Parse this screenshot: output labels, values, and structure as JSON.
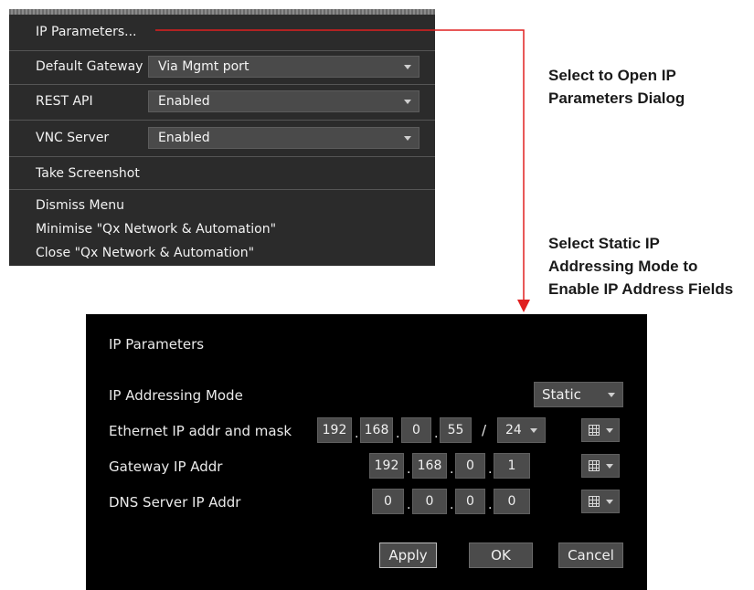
{
  "menu": {
    "ip_parameters": "IP Parameters...",
    "default_gateway": {
      "label": "Default Gateway",
      "value": "Via Mgmt port"
    },
    "rest_api": {
      "label": "REST API",
      "value": "Enabled"
    },
    "vnc_server": {
      "label": "VNC Server",
      "value": "Enabled"
    },
    "take_screenshot": "Take Screenshot",
    "dismiss_menu": "Dismiss Menu",
    "minimise": "Minimise \"Qx Network & Automation\"",
    "close": "Close \"Qx Network & Automation\""
  },
  "callouts": {
    "first": [
      "Select to Open IP",
      "Parameters Dialog"
    ],
    "second": [
      "Select Static IP",
      "Addressing Mode to",
      "Enable IP Address Fields"
    ]
  },
  "dialog": {
    "title": "IP Parameters",
    "addressing_mode": {
      "label": "IP Addressing Mode",
      "value": "Static"
    },
    "ethernet": {
      "label": "Ethernet IP addr and mask",
      "octets": [
        "192",
        "168",
        "0",
        "55"
      ],
      "mask": "24"
    },
    "gateway": {
      "label": "Gateway IP Addr",
      "octets": [
        "192",
        "168",
        "0",
        "1"
      ]
    },
    "dns": {
      "label": "DNS Server IP Addr",
      "octets": [
        "0",
        "0",
        "0",
        "0"
      ]
    },
    "buttons": {
      "apply": "Apply",
      "ok": "OK",
      "cancel": "Cancel"
    }
  },
  "colors": {
    "arrow": "#e02020",
    "menu_bg": "#2b2b2b",
    "dialog_bg": "#000000"
  },
  "icons": {
    "dropdown": "chevron-down-icon",
    "keypad": "grid-icon"
  }
}
